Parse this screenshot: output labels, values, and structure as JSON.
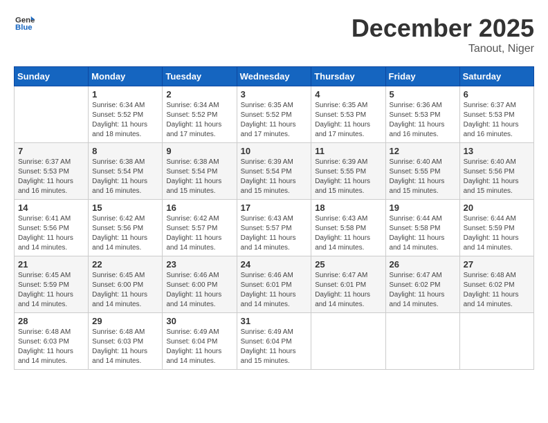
{
  "header": {
    "logo_general": "General",
    "logo_blue": "Blue",
    "month_year": "December 2025",
    "location": "Tanout, Niger"
  },
  "days_of_week": [
    "Sunday",
    "Monday",
    "Tuesday",
    "Wednesday",
    "Thursday",
    "Friday",
    "Saturday"
  ],
  "weeks": [
    [
      {
        "day": "",
        "sunrise": "",
        "sunset": "",
        "daylight": ""
      },
      {
        "day": "1",
        "sunrise": "6:34 AM",
        "sunset": "5:52 PM",
        "daylight": "11 hours and 18 minutes."
      },
      {
        "day": "2",
        "sunrise": "6:34 AM",
        "sunset": "5:52 PM",
        "daylight": "11 hours and 17 minutes."
      },
      {
        "day": "3",
        "sunrise": "6:35 AM",
        "sunset": "5:52 PM",
        "daylight": "11 hours and 17 minutes."
      },
      {
        "day": "4",
        "sunrise": "6:35 AM",
        "sunset": "5:53 PM",
        "daylight": "11 hours and 17 minutes."
      },
      {
        "day": "5",
        "sunrise": "6:36 AM",
        "sunset": "5:53 PM",
        "daylight": "11 hours and 16 minutes."
      },
      {
        "day": "6",
        "sunrise": "6:37 AM",
        "sunset": "5:53 PM",
        "daylight": "11 hours and 16 minutes."
      }
    ],
    [
      {
        "day": "7",
        "sunrise": "6:37 AM",
        "sunset": "5:53 PM",
        "daylight": "11 hours and 16 minutes."
      },
      {
        "day": "8",
        "sunrise": "6:38 AM",
        "sunset": "5:54 PM",
        "daylight": "11 hours and 16 minutes."
      },
      {
        "day": "9",
        "sunrise": "6:38 AM",
        "sunset": "5:54 PM",
        "daylight": "11 hours and 15 minutes."
      },
      {
        "day": "10",
        "sunrise": "6:39 AM",
        "sunset": "5:54 PM",
        "daylight": "11 hours and 15 minutes."
      },
      {
        "day": "11",
        "sunrise": "6:39 AM",
        "sunset": "5:55 PM",
        "daylight": "11 hours and 15 minutes."
      },
      {
        "day": "12",
        "sunrise": "6:40 AM",
        "sunset": "5:55 PM",
        "daylight": "11 hours and 15 minutes."
      },
      {
        "day": "13",
        "sunrise": "6:40 AM",
        "sunset": "5:56 PM",
        "daylight": "11 hours and 15 minutes."
      }
    ],
    [
      {
        "day": "14",
        "sunrise": "6:41 AM",
        "sunset": "5:56 PM",
        "daylight": "11 hours and 14 minutes."
      },
      {
        "day": "15",
        "sunrise": "6:42 AM",
        "sunset": "5:56 PM",
        "daylight": "11 hours and 14 minutes."
      },
      {
        "day": "16",
        "sunrise": "6:42 AM",
        "sunset": "5:57 PM",
        "daylight": "11 hours and 14 minutes."
      },
      {
        "day": "17",
        "sunrise": "6:43 AM",
        "sunset": "5:57 PM",
        "daylight": "11 hours and 14 minutes."
      },
      {
        "day": "18",
        "sunrise": "6:43 AM",
        "sunset": "5:58 PM",
        "daylight": "11 hours and 14 minutes."
      },
      {
        "day": "19",
        "sunrise": "6:44 AM",
        "sunset": "5:58 PM",
        "daylight": "11 hours and 14 minutes."
      },
      {
        "day": "20",
        "sunrise": "6:44 AM",
        "sunset": "5:59 PM",
        "daylight": "11 hours and 14 minutes."
      }
    ],
    [
      {
        "day": "21",
        "sunrise": "6:45 AM",
        "sunset": "5:59 PM",
        "daylight": "11 hours and 14 minutes."
      },
      {
        "day": "22",
        "sunrise": "6:45 AM",
        "sunset": "6:00 PM",
        "daylight": "11 hours and 14 minutes."
      },
      {
        "day": "23",
        "sunrise": "6:46 AM",
        "sunset": "6:00 PM",
        "daylight": "11 hours and 14 minutes."
      },
      {
        "day": "24",
        "sunrise": "6:46 AM",
        "sunset": "6:01 PM",
        "daylight": "11 hours and 14 minutes."
      },
      {
        "day": "25",
        "sunrise": "6:47 AM",
        "sunset": "6:01 PM",
        "daylight": "11 hours and 14 minutes."
      },
      {
        "day": "26",
        "sunrise": "6:47 AM",
        "sunset": "6:02 PM",
        "daylight": "11 hours and 14 minutes."
      },
      {
        "day": "27",
        "sunrise": "6:48 AM",
        "sunset": "6:02 PM",
        "daylight": "11 hours and 14 minutes."
      }
    ],
    [
      {
        "day": "28",
        "sunrise": "6:48 AM",
        "sunset": "6:03 PM",
        "daylight": "11 hours and 14 minutes."
      },
      {
        "day": "29",
        "sunrise": "6:48 AM",
        "sunset": "6:03 PM",
        "daylight": "11 hours and 14 minutes."
      },
      {
        "day": "30",
        "sunrise": "6:49 AM",
        "sunset": "6:04 PM",
        "daylight": "11 hours and 14 minutes."
      },
      {
        "day": "31",
        "sunrise": "6:49 AM",
        "sunset": "6:04 PM",
        "daylight": "11 hours and 15 minutes."
      },
      {
        "day": "",
        "sunrise": "",
        "sunset": "",
        "daylight": ""
      },
      {
        "day": "",
        "sunrise": "",
        "sunset": "",
        "daylight": ""
      },
      {
        "day": "",
        "sunrise": "",
        "sunset": "",
        "daylight": ""
      }
    ]
  ]
}
